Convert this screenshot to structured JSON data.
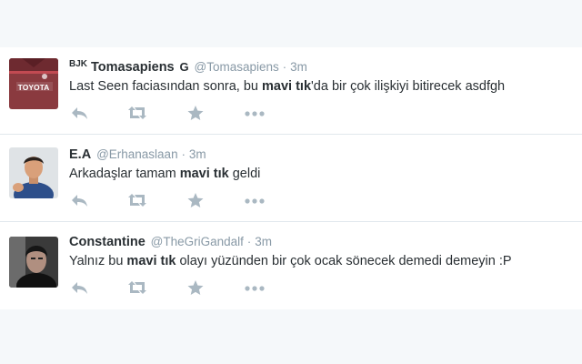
{
  "colors": {
    "text": "#292f33",
    "muted": "#8899a6",
    "icon": "#aab8c2",
    "border": "#e1e8ed",
    "background": "#f5f8fa"
  },
  "tweets": [
    {
      "prefix": "BJK",
      "fullname": "Tomasapiens",
      "suffix": "G",
      "username": "@Tomasapiens",
      "separator": "·",
      "time": "3m",
      "text_before": "Last Seen faciasından sonra, bu ",
      "text_bold": "mavi tık",
      "text_after": "'da bir çok ilişkiyi bitirecek asdfgh",
      "avatar": {
        "jersey_text": "TOYOTA"
      },
      "icons": [
        "reply-icon",
        "retweet-icon",
        "favorite-icon",
        "more-icon"
      ]
    },
    {
      "prefix": "",
      "fullname": "E.A",
      "suffix": "",
      "username": "@Erhanaslaan",
      "separator": "·",
      "time": "3m",
      "text_before": "Arkadaşlar tamam ",
      "text_bold": "mavi tık",
      "text_after": " geldi",
      "icons": [
        "reply-icon",
        "retweet-icon",
        "favorite-icon",
        "more-icon"
      ]
    },
    {
      "prefix": "",
      "fullname": "Constantine",
      "suffix": "",
      "username": "@TheGriGandalf",
      "separator": "·",
      "time": "3m",
      "text_before": "Yalnız bu ",
      "text_bold": "mavi tık",
      "text_after": " olayı yüzünden bir çok ocak sönecek demedi demeyin :P",
      "icons": [
        "reply-icon",
        "retweet-icon",
        "favorite-icon",
        "more-icon"
      ]
    }
  ]
}
